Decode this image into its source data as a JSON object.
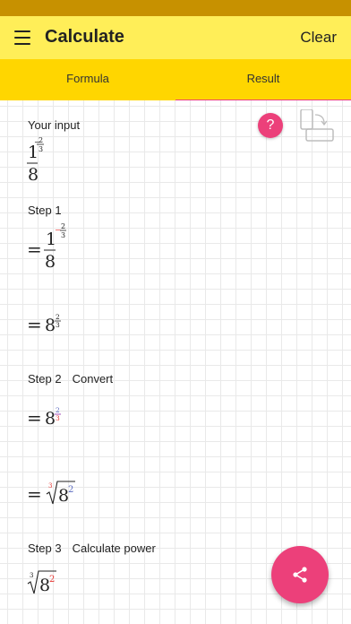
{
  "app": {
    "title": "Calculate",
    "clear_label": "Clear"
  },
  "tabs": [
    {
      "label": "Formula",
      "active": false
    },
    {
      "label": "Result",
      "active": true
    }
  ],
  "help": {
    "label": "?"
  },
  "input": {
    "label": "Your input",
    "numerator": "1",
    "denominator": "8",
    "exponent_sign": "−",
    "exponent_num": "2",
    "exponent_den": "3"
  },
  "step1": {
    "label": "Step 1",
    "line1": {
      "equals": "=",
      "numerator": "1",
      "denominator": "8",
      "exponent_sign": "−",
      "exponent_num": "2",
      "exponent_den": "3"
    },
    "line2": {
      "equals": "=",
      "base": "8",
      "exponent_num": "2",
      "exponent_den": "3"
    }
  },
  "step2": {
    "label": "Step 2",
    "description": "Convert",
    "line1": {
      "equals": "=",
      "base": "8",
      "exponent_num": "2",
      "exponent_den": "3"
    },
    "line2": {
      "equals": "=",
      "root_index": "3",
      "base": "8",
      "power": "2"
    }
  },
  "step3": {
    "label": "Step 3",
    "description": "Calculate power",
    "line1": {
      "root_index": "3",
      "base": "8",
      "power": "2"
    }
  },
  "colors": {
    "appbar": "#ffee58",
    "tabbar": "#ffd600",
    "status_bar": "#c79100",
    "accent": "#ec407a",
    "highlight_red": "#e53935",
    "highlight_blue": "#5c6bc0"
  },
  "icons": {
    "menu": "menu-icon",
    "rotate": "rotate-screen-icon",
    "share": "share-icon"
  }
}
